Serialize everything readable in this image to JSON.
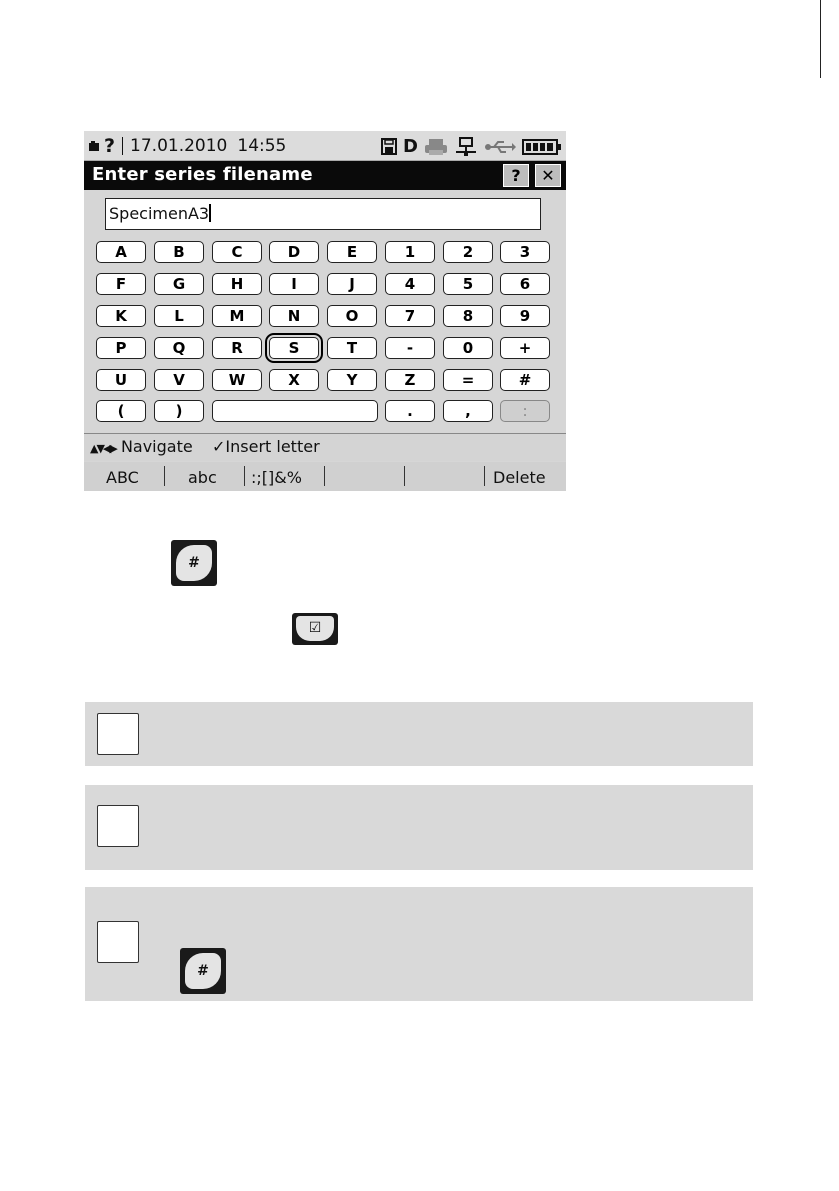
{
  "status_bar": {
    "help_mark": "?",
    "date": "17.01.2010",
    "time": "14:55",
    "drive_label": "D",
    "icons": [
      "battery-small-icon",
      "floppy-disk-icon",
      "printer-icon",
      "network-icon",
      "usb-icon",
      "battery-full-icon"
    ]
  },
  "dialog": {
    "title": "Enter series filename",
    "help_button": "?",
    "close_button": "✕"
  },
  "input": {
    "value": "SpecimenA3"
  },
  "keyboard": {
    "rows": [
      [
        "A",
        "B",
        "C",
        "D",
        "E",
        "1",
        "2",
        "3"
      ],
      [
        "F",
        "G",
        "H",
        "I",
        "J",
        "4",
        "5",
        "6"
      ],
      [
        "K",
        "L",
        "M",
        "N",
        "O",
        "7",
        "8",
        "9"
      ],
      [
        "P",
        "Q",
        "R",
        "S",
        "T",
        "-",
        "0",
        "+"
      ],
      [
        "U",
        "V",
        "W",
        "X",
        "Y",
        "Z",
        "=",
        "#"
      ]
    ],
    "last_row": {
      "open_paren": "(",
      "close_paren": ")",
      "period": ".",
      "comma": ",",
      "colon": ":"
    },
    "selected_key": "S",
    "disabled_key": ":"
  },
  "navigation": {
    "nav_arrows": "▲▼◀▶",
    "navigate_label": "Navigate",
    "insert_check": "✓",
    "insert_label": "Insert letter"
  },
  "softkeys": {
    "abc_upper": "ABC",
    "abc_lower": "abc",
    "symbols": ":;[]&%",
    "delete": "Delete"
  },
  "icons": {
    "hash_key_glyph": "#",
    "check_key_glyph": "☑"
  }
}
